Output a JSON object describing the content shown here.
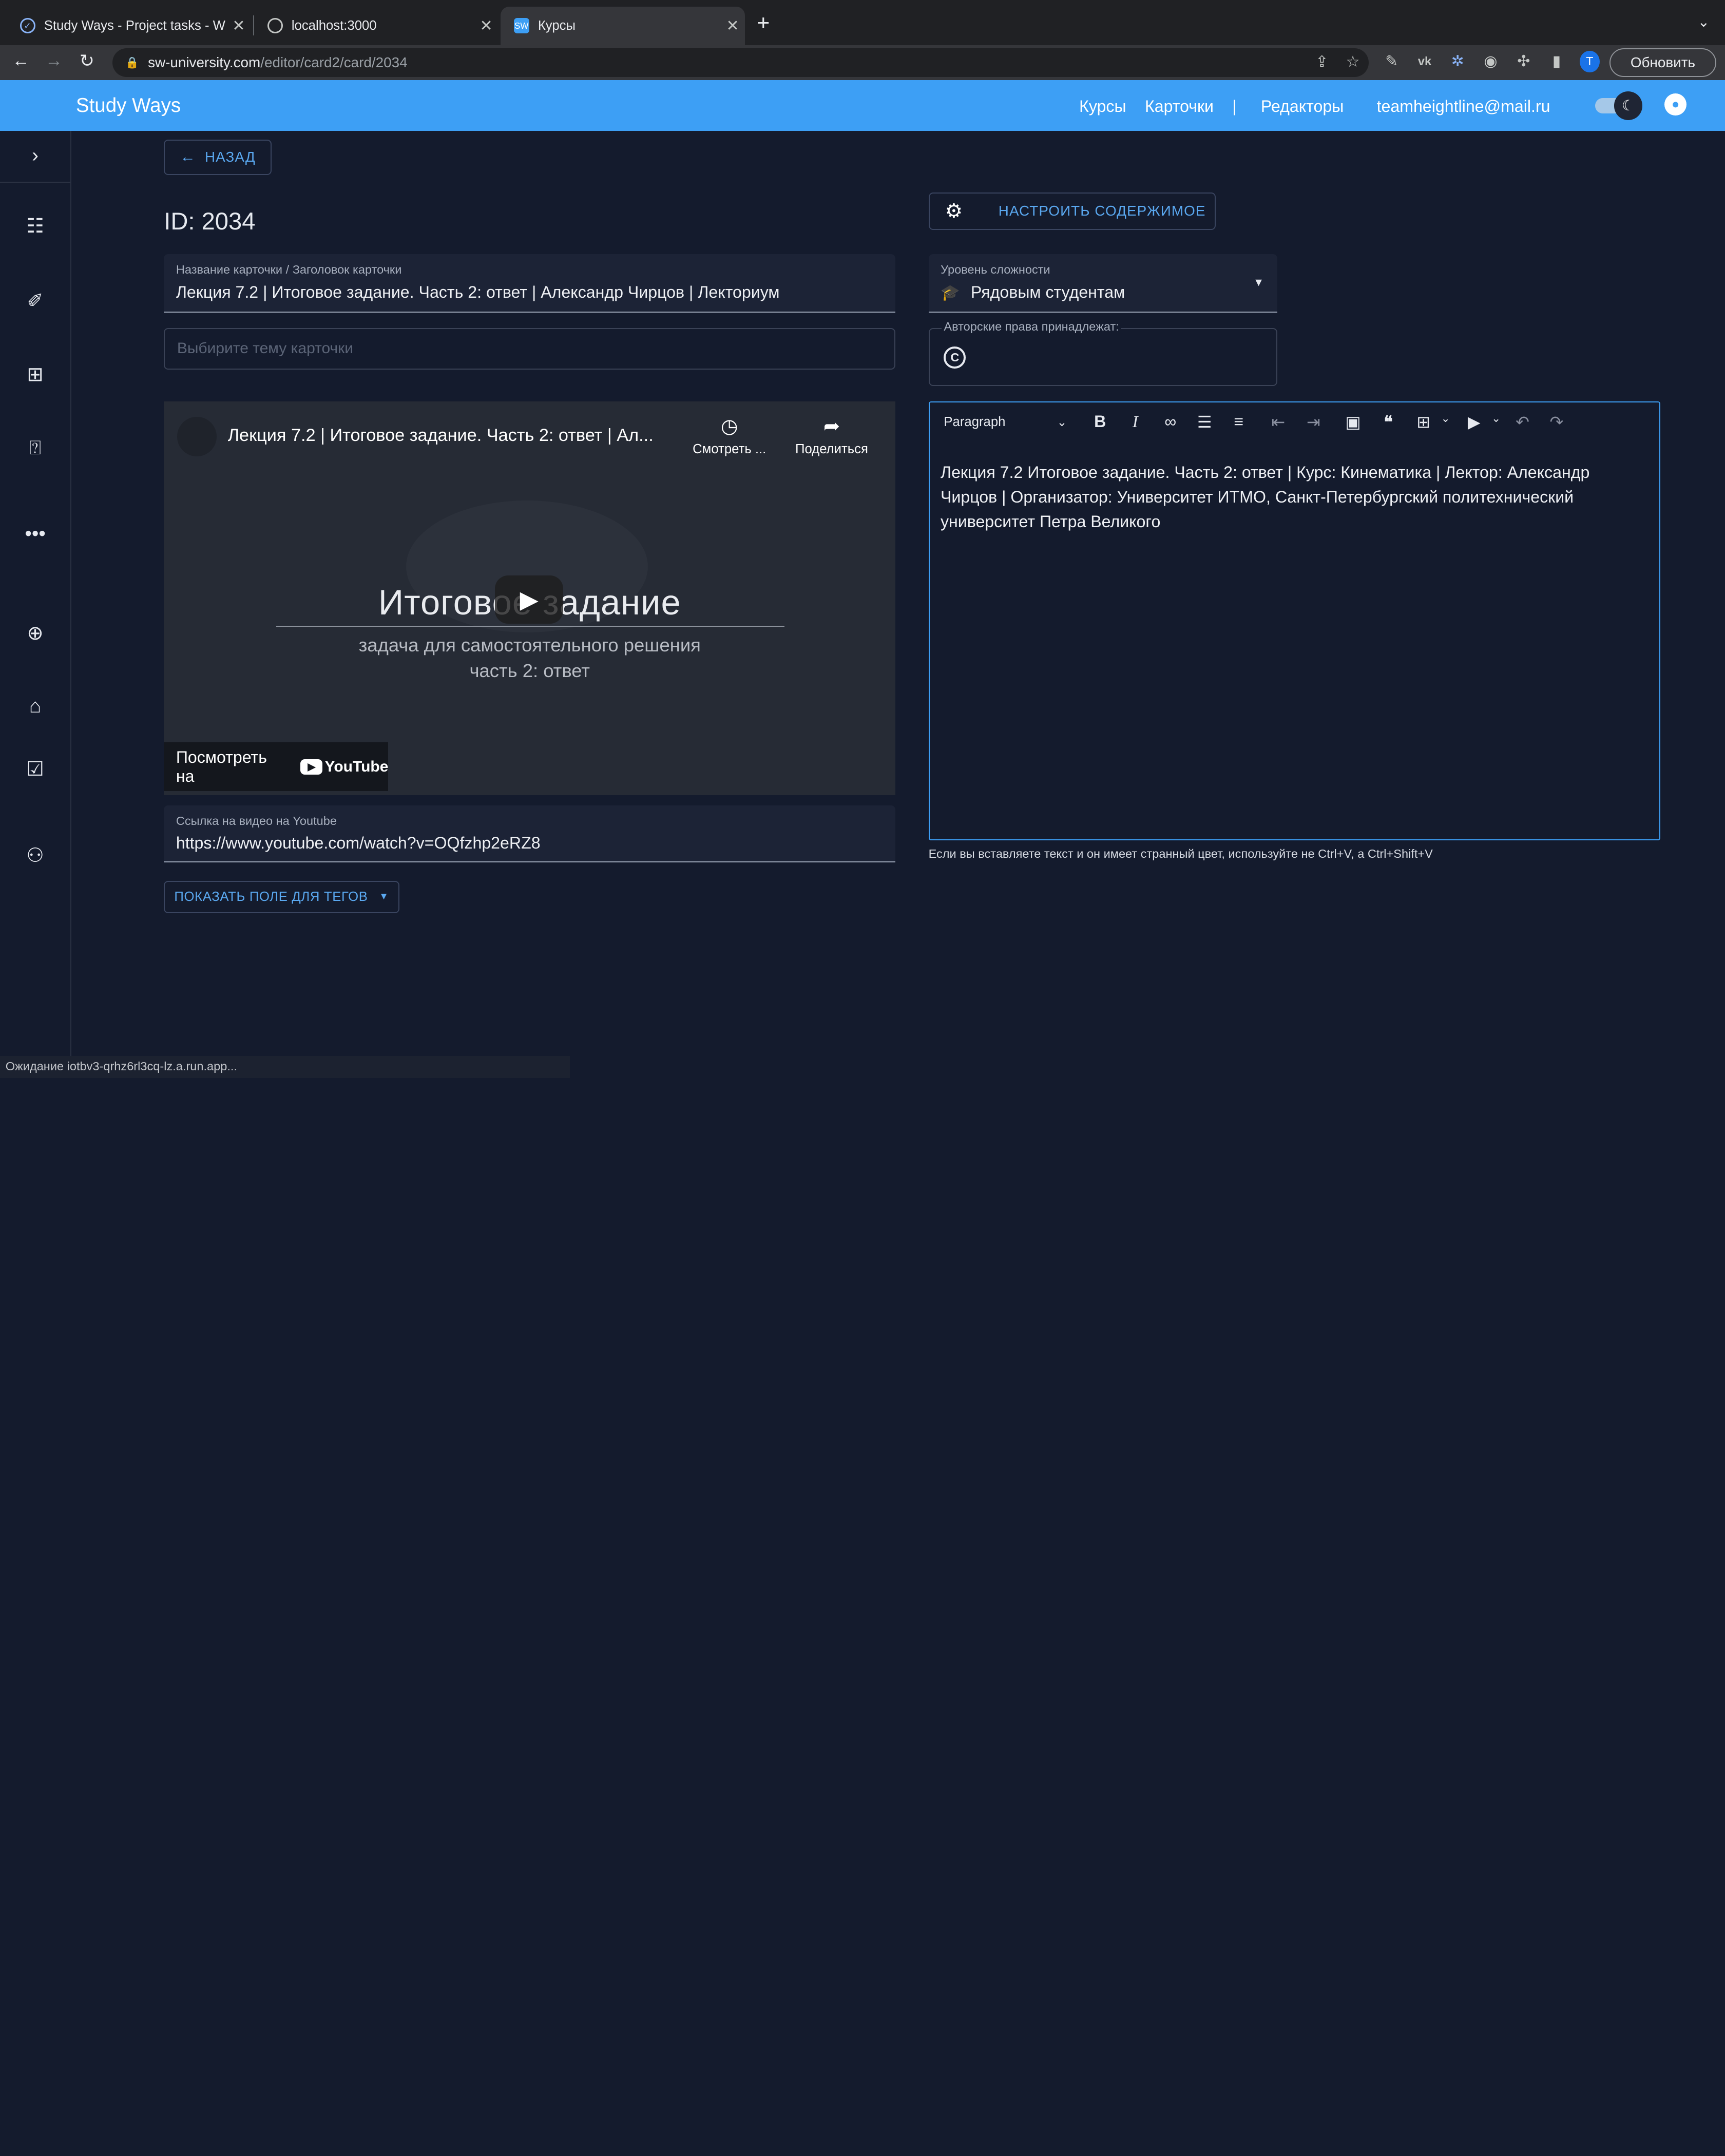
{
  "browser": {
    "tabs": [
      {
        "title": "Study Ways - Project tasks - W",
        "favicon": "check-circle-icon"
      },
      {
        "title": "localhost:3000",
        "favicon": "globe-icon"
      },
      {
        "title": "Курсы",
        "favicon": "SW"
      }
    ],
    "url_domain": "sw-university.com",
    "url_path": "/editor/card2/card/2034",
    "profile_initial": "T",
    "update_label": "Обновить"
  },
  "app": {
    "brand": "Study Ways",
    "nav": {
      "courses": "Курсы",
      "cards": "Карточки",
      "separator": "|",
      "editors": "Редакторы",
      "email": "teamheightline@mail.ru"
    },
    "accent": "#3d9ff5"
  },
  "main": {
    "back_label": "НАЗАД",
    "id_label": "ID: 2034",
    "card_title": {
      "label": "Название карточки / Заголовок карточки",
      "value": "Лекция 7.2 | Итоговое задание. Часть 2: ответ | Александр Чирцов | Лекториум"
    },
    "topic_placeholder": "Выбирите тему карточки",
    "video": {
      "title": "Лекция 7.2 | Итоговое задание. Часть 2: ответ | Ал...",
      "watch_later": "Смотреть ...",
      "share": "Поделиться",
      "big_title": "Итоговое задание",
      "subtitle_1": "задача для самостоятельного решения",
      "subtitle_2": "часть 2: ответ",
      "watch_on": "Посмотреть на",
      "youtube": "YouTube"
    },
    "youtube_link": {
      "label": "Ссылка на видео на Youtube",
      "value": "https://www.youtube.com/watch?v=OQfzhp2eRZ8"
    },
    "tags_button": "ПОКАЗАТЬ ПОЛЕ ДЛЯ ТЕГОВ"
  },
  "right": {
    "configure_label": "НАСТРОИТЬ СОДЕРЖИМОЕ",
    "difficulty": {
      "label": "Уровень сложности",
      "value": "Рядовым студентам"
    },
    "copyright_label": "Авторские права принадлежат:",
    "editor": {
      "block_format": "Paragraph",
      "text": "Лекция 7.2 Итоговое задание. Часть 2: ответ | Курс: Кинематика | Лектор: Александр Чирцов | Организатор: Университет ИТМО, Санкт-Петербургский политехнический университет Петра Великого"
    },
    "paste_hint": "Если вы вставляете текст и он имеет странный цвет, используйте не Ctrl+V, а Ctrl+Shift+V"
  },
  "status_text": "Ожидание iotbv3-qrhz6rl3cq-lz.a.run.app..."
}
